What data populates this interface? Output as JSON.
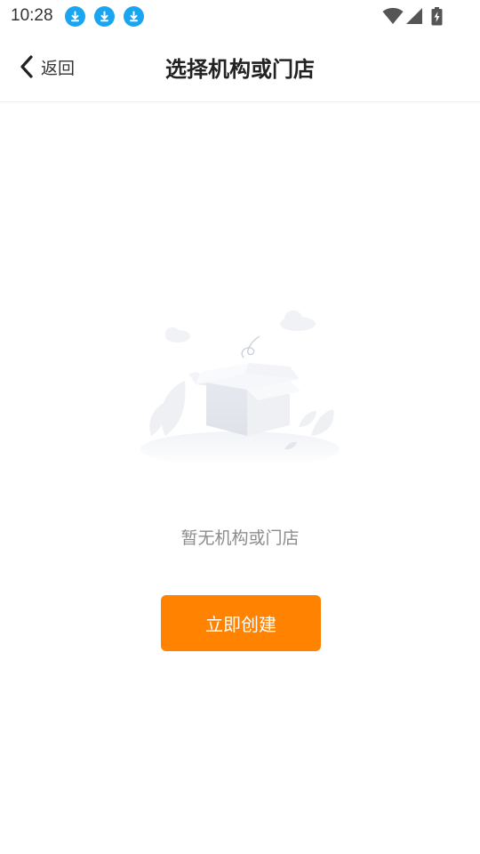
{
  "status_bar": {
    "time": "10:28",
    "notification_icons": [
      "download-icon",
      "download-icon",
      "download-icon"
    ],
    "accent_color": "#1aa5f0"
  },
  "nav": {
    "back_label": "返回",
    "title": "选择机构或门店"
  },
  "empty_state": {
    "message": "暂无机构或门店",
    "illustration": "empty-box-icon"
  },
  "actions": {
    "create_label": "立即创建",
    "create_color": "#ff8200"
  }
}
